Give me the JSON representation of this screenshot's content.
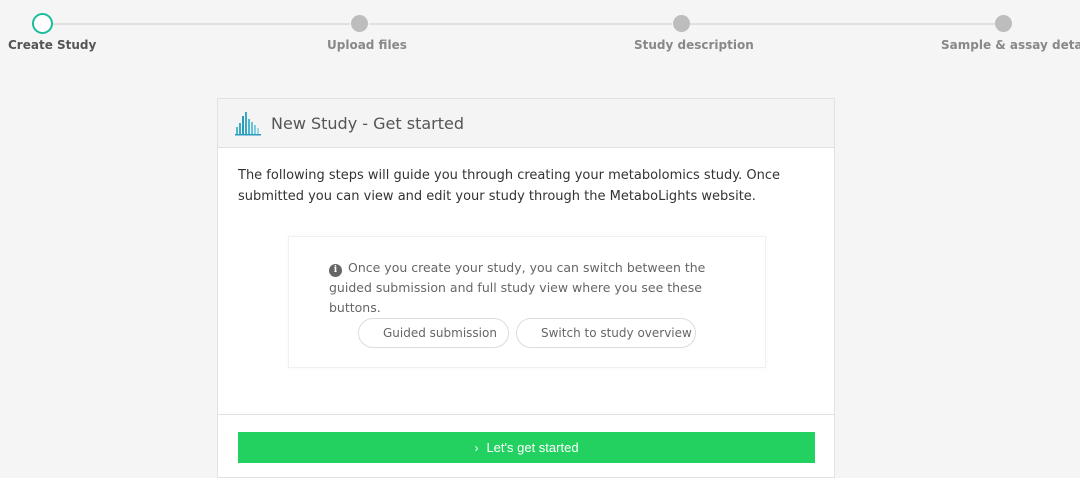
{
  "stepper": {
    "steps": [
      {
        "label": "Create Study",
        "active": true
      },
      {
        "label": "Upload files",
        "active": false
      },
      {
        "label": "Study description",
        "active": false
      },
      {
        "label": "Sample & assay details",
        "active": false
      }
    ],
    "active_color": "#1bbc9b"
  },
  "card": {
    "title": "New Study - Get started",
    "intro": "The following steps will guide you through creating your metabolomics study. Once submitted you can view and edit your study through the MetaboLights website.",
    "info": {
      "icon": "info-icon",
      "text": "Once you create your study, you can switch between the guided submission and full study view where you see these buttons.",
      "guided_button": {
        "label": "Guided submission",
        "icon": "guided-submission-icon"
      },
      "overview_button": {
        "label": "Switch to study overview",
        "icon": "study-overview-icon"
      }
    },
    "start_button": {
      "label": "Let's get started",
      "icon": "chevron-right-icon",
      "color": "#23d160"
    }
  }
}
